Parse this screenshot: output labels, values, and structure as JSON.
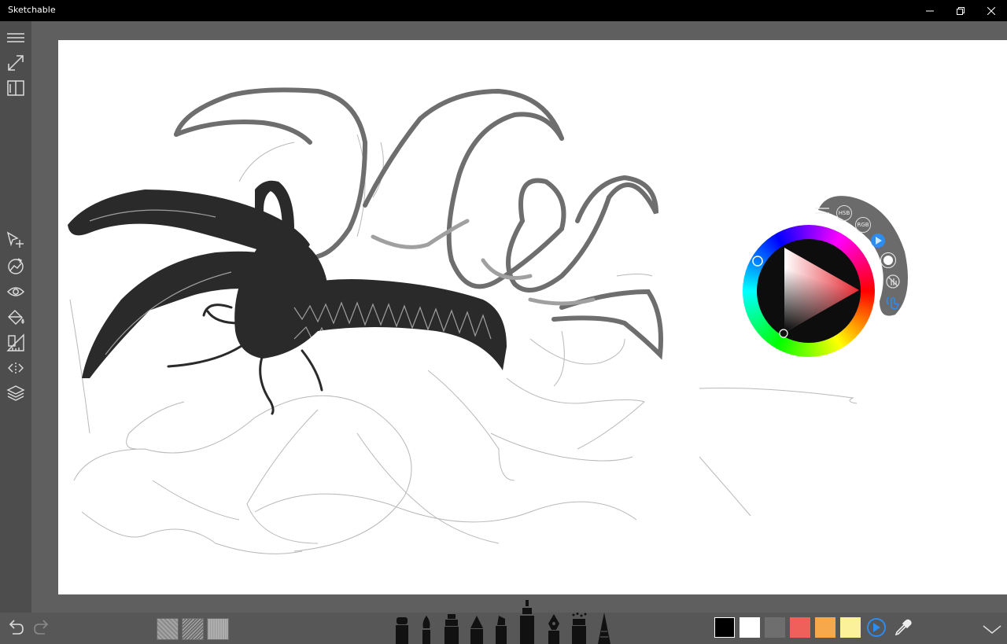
{
  "app": {
    "title": "Sketchable"
  },
  "window_controls": {
    "minimize": "minimize-icon",
    "restore": "restore-icon",
    "close": "close-icon"
  },
  "left_toolbar": {
    "top": [
      "menu-icon",
      "fullscreen-icon",
      "journal-icon"
    ],
    "tools": [
      "selection-icon",
      "transform-icon",
      "visibility-icon",
      "fill-icon",
      "ruler-icon",
      "symmetry-icon",
      "layers-icon"
    ]
  },
  "color_picker": {
    "modes": {
      "hsb": "HSB",
      "rgb": "RGB"
    },
    "selected_color": "#e3262f",
    "buttons": [
      "menu-icon",
      "play-icon",
      "circle-icon",
      "no-touch-icon",
      "touch-icon"
    ]
  },
  "bottom_toolbar": {
    "history": [
      "undo-icon",
      "redo-icon"
    ],
    "textures": [
      "texture-1",
      "texture-2",
      "texture-3"
    ],
    "brushes": [
      "marker",
      "brush",
      "airbrush",
      "pencil",
      "highlighter",
      "fineliner",
      "ink-pen",
      "spray",
      "cone"
    ],
    "active_brush": "fineliner",
    "swatches": [
      "#000000",
      "#ffffff",
      "#6e6e6e",
      "#f0605b",
      "#f7a84a",
      "#fbf19a"
    ],
    "accent": "#2d8cf0"
  }
}
